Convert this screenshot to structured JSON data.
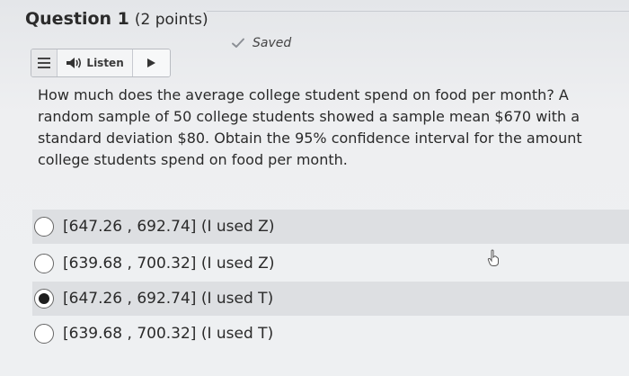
{
  "question": {
    "title": "Question 1",
    "points": "(2 points)",
    "saved_label": "Saved",
    "text": "How much does the average college student spend on food per month? A random sample of 50 college students showed a sample mean $670 with a standard deviation $80. Obtain the 95% confidence interval for the amount college students spend on food per month."
  },
  "toolbar": {
    "listen_label": "Listen",
    "icons": [
      "menu-icon",
      "speaker-icon",
      "play-icon"
    ]
  },
  "options": [
    {
      "label": "[647.26 , 692.74] (I used Z)",
      "selected": false
    },
    {
      "label": "[639.68 , 700.32] (I used Z)",
      "selected": false
    },
    {
      "label": "[647.26 , 692.74] (I used T)",
      "selected": true
    },
    {
      "label": "[639.68 , 700.32] (I used T)",
      "selected": false
    }
  ],
  "colors": {
    "background": "#e9ebee",
    "selected_row": "#dddfe2",
    "text": "#2a2a2a"
  }
}
